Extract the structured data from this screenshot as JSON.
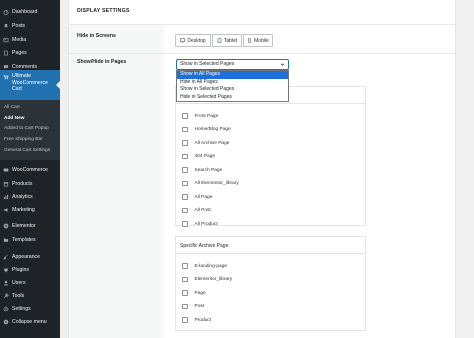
{
  "sidebar": {
    "items": [
      {
        "label": "Dashboard",
        "icon": "dashboard-icon"
      },
      {
        "label": "Posts",
        "icon": "pin-icon"
      },
      {
        "label": "Media",
        "icon": "media-icon"
      },
      {
        "label": "Pages",
        "icon": "page-icon"
      },
      {
        "label": "Comments",
        "icon": "comment-icon"
      },
      {
        "label": "Ultimate WooCommerce Cart",
        "icon": "cart-icon"
      }
    ],
    "submenu": [
      "All Cart",
      "Add New",
      "Added to Cart Popup",
      "Free Shipping Bar",
      "General Cart Settings"
    ],
    "items2": [
      {
        "label": "WooCommerce",
        "icon": "woo-icon"
      },
      {
        "label": "Products",
        "icon": "box-icon"
      },
      {
        "label": "Analytics",
        "icon": "chart-icon"
      },
      {
        "label": "Marketing",
        "icon": "megaphone-icon"
      },
      {
        "label": "Elementor",
        "icon": "elementor-icon"
      },
      {
        "label": "Templates",
        "icon": "folder-icon"
      },
      {
        "label": "Appearance",
        "icon": "brush-icon"
      },
      {
        "label": "Plugins",
        "icon": "plug-icon"
      },
      {
        "label": "Users",
        "icon": "user-icon"
      },
      {
        "label": "Tools",
        "icon": "wrench-icon"
      },
      {
        "label": "Settings",
        "icon": "settings-icon"
      },
      {
        "label": "Collapse menu",
        "icon": "collapse-icon"
      }
    ]
  },
  "section_title": "DISPLAY SETTINGS",
  "hide_in_screens": {
    "label": "Hide in Screens",
    "options": [
      {
        "label": "Desktop",
        "icon": "desktop-icon"
      },
      {
        "label": "Tablet",
        "icon": "tablet-icon"
      },
      {
        "label": "Mobile",
        "icon": "mobile-icon"
      }
    ]
  },
  "show_hide_pages": {
    "label": "Show/Hide in Pages",
    "selected": "Show in Selected Pages",
    "options": [
      "Show in All Pages",
      "Hide in All Pages",
      "Show in Selected Pages",
      "Hide in Selected Pages"
    ],
    "highlighted_index": 0
  },
  "pages_card": {
    "items": [
      "Front Page",
      "Home/Blog Page",
      "All Archive Page",
      "404 Page",
      "Search Page",
      "All Elementor_library",
      "All Page",
      "All Post",
      "All Product"
    ]
  },
  "archive_card": {
    "title": "Specific Archive Page",
    "items": [
      "E-landing-page",
      "Elementor_library",
      "Page",
      "Post",
      "Product"
    ]
  },
  "colors": {
    "sidebar_bg": "#1d2327",
    "accent": "#2271b1",
    "selected_option": "#1e6fd9"
  }
}
